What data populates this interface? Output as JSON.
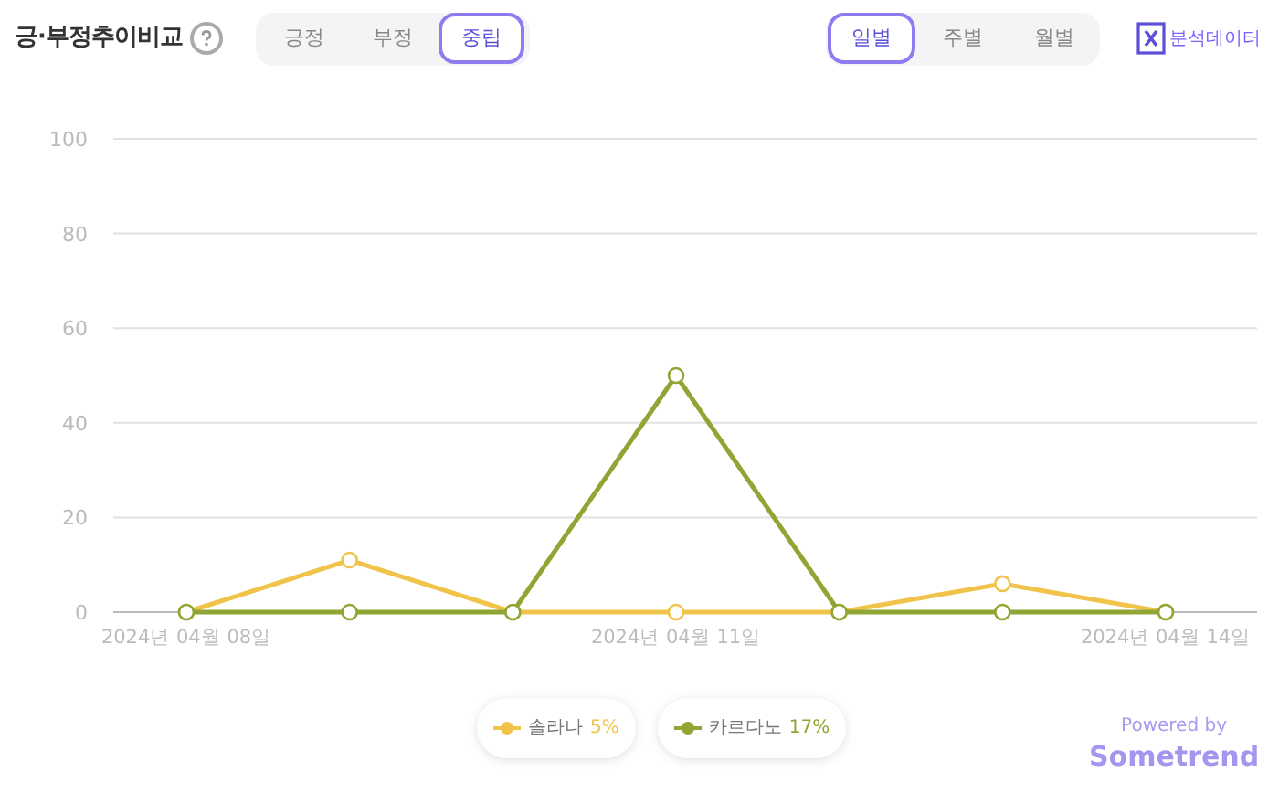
{
  "title": "긍·부정추이비교",
  "sentiment_tabs": [
    {
      "label": "긍정",
      "selected": false
    },
    {
      "label": "부정",
      "selected": false
    },
    {
      "label": "중립",
      "selected": true
    }
  ],
  "period_tabs": [
    {
      "label": "일별",
      "selected": true
    },
    {
      "label": "주별",
      "selected": false
    },
    {
      "label": "월별",
      "selected": false
    }
  ],
  "export_label": "분석데이터",
  "chart_data": {
    "type": "line",
    "categories": [
      "2024년 04월 08일",
      null,
      null,
      "2024년 04월 11일",
      null,
      null,
      "2024년 04월 14일"
    ],
    "ylim": [
      0,
      100
    ],
    "grid": true,
    "yticks": [
      0,
      20,
      40,
      60,
      80,
      100
    ],
    "series": [
      {
        "name": "솔라나",
        "color": "#f2c34a",
        "marker": "circle",
        "values": [
          0,
          11,
          0,
          0,
          0,
          6,
          0
        ]
      },
      {
        "name": "카르다노",
        "color": "#8fa635",
        "marker": "circle",
        "values": [
          0,
          0,
          0,
          50,
          0,
          0,
          0
        ]
      }
    ]
  },
  "legend": [
    {
      "share": "5%"
    },
    {
      "share": "17%"
    }
  ],
  "powered_by": "Powered by",
  "brand": "Sometrend"
}
